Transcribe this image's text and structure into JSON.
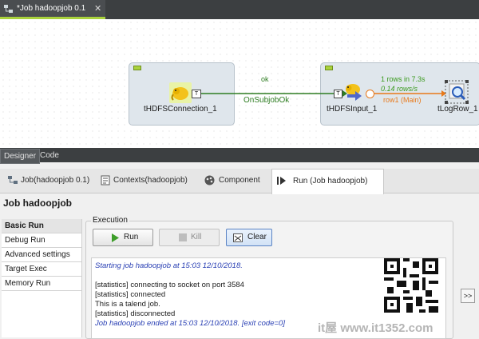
{
  "editor": {
    "tab_title": "*Job hadoopjob 0.1",
    "close_glyph": "✕"
  },
  "canvas": {
    "components": [
      {
        "label": "tHDFSConnection_1",
        "icon": "hadoop-elephant-icon"
      },
      {
        "label": "tHDFSInput_1",
        "icon": "hadoop-input-icon"
      },
      {
        "label": "tLogRow_1",
        "icon": "magnifier-icon"
      }
    ],
    "connections": {
      "trigger_label": "ok",
      "trigger_name": "OnSubjobOk",
      "row_stats_rows": "1 rows in 7.3s",
      "row_stats_rate": "0.14 rows/s",
      "row_name": "row1 (Main)"
    },
    "colors": {
      "subjob_ok": "#2e7d22",
      "row_main": "#e8791a",
      "stats_green": "#3a9a1e"
    }
  },
  "designer_tabs": [
    "Designer",
    "Code"
  ],
  "views_tabs": [
    {
      "label": "Job(hadoopjob 0.1)",
      "icon": "job-icon"
    },
    {
      "label": "Contexts(hadoopjob)",
      "icon": "contexts-icon"
    },
    {
      "label": "Component",
      "icon": "component-icon"
    },
    {
      "label": "Run (Job hadoopjob)",
      "icon": "run-view-icon"
    }
  ],
  "run": {
    "title": "Job hadoopjob",
    "menu": [
      "Basic Run",
      "Debug Run",
      "Advanced settings",
      "Target Exec",
      "Memory Run"
    ],
    "execution_label": "Execution",
    "buttons": {
      "run": "Run",
      "kill": "Kill",
      "clear": "Clear"
    },
    "console": [
      {
        "text": "Starting job hadoopjob at 15:03 12/10/2018.",
        "kind": "info"
      },
      {
        "text": "[statistics] connecting to socket on port 3584",
        "kind": "std"
      },
      {
        "text": "[statistics] connected",
        "kind": "std"
      },
      {
        "text": "This is a talend job.",
        "kind": "std"
      },
      {
        "text": "[statistics] disconnected",
        "kind": "std"
      },
      {
        "text": "Job hadoopjob ended at 15:03 12/10/2018. [exit code=0]",
        "kind": "info"
      }
    ],
    "scroll_label": ">>"
  },
  "watermark": "it屋 www.it1352.com"
}
